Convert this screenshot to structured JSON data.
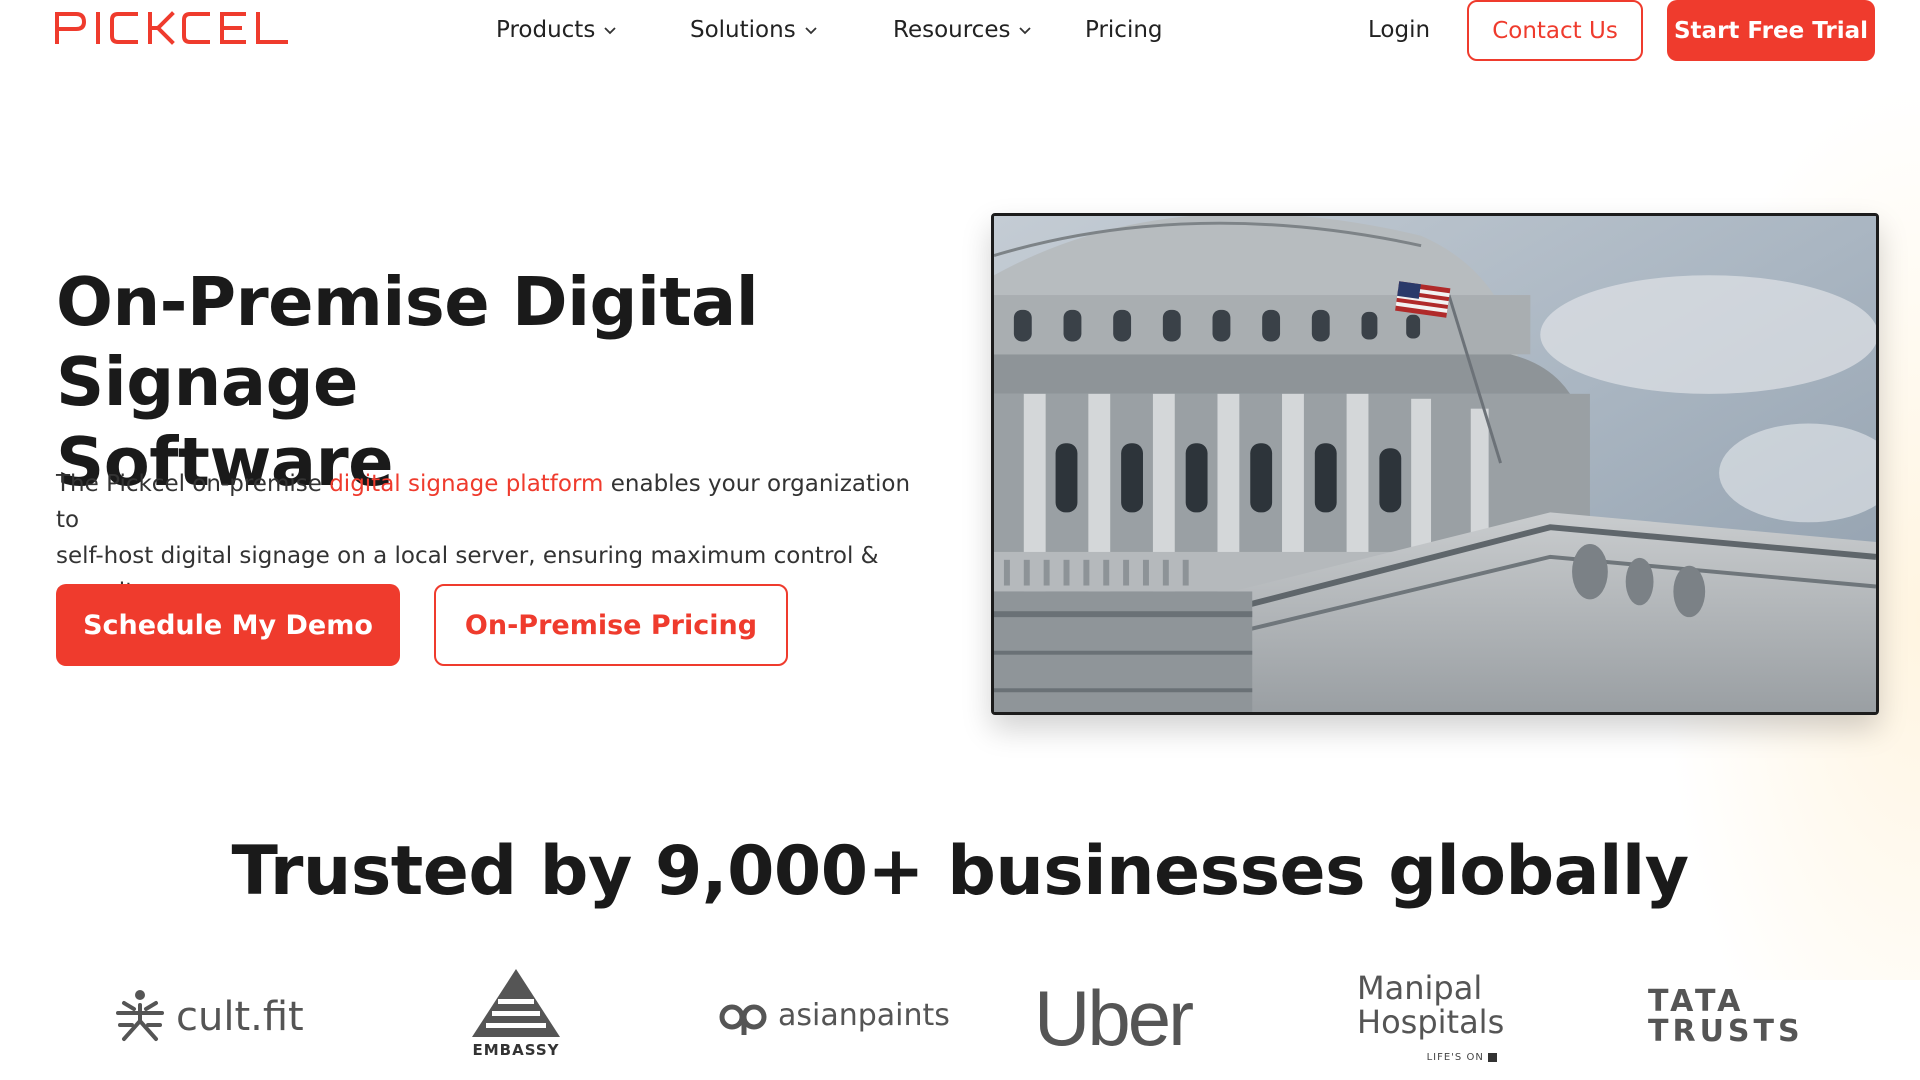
{
  "brand": {
    "logo_text": "PICKCEL",
    "accent_color": "#ef3b2d"
  },
  "nav": {
    "items": [
      {
        "label": "Products",
        "has_dropdown": true
      },
      {
        "label": "Solutions",
        "has_dropdown": true
      },
      {
        "label": "Resources",
        "has_dropdown": true
      },
      {
        "label": "Pricing",
        "has_dropdown": false
      }
    ],
    "login": "Login",
    "contact": "Contact Us",
    "trial": "Start Free Trial"
  },
  "hero": {
    "title_line1": "On-Premise Digital Signage",
    "title_line2": "Software",
    "desc_before": "The Pickcel on-premise ",
    "desc_link": "digital signage platform",
    "desc_after_line1": " enables your organization to",
    "desc_line2": "self-host digital signage on a local server, ensuring maximum control & security",
    "primary_button": "Schedule My Demo",
    "secondary_button": "On-Premise Pricing",
    "image_icon": "capitol-building-photo"
  },
  "trust": {
    "heading": "Trusted by 9,000+ businesses globally",
    "logos": {
      "cultfit": "cult.fit",
      "embassy": "EMBASSY",
      "asianpaints": "asianpaints",
      "uber": "Uber",
      "manipal_line1": "Manipal",
      "manipal_line2": "Hospitals",
      "manipal_tag": "LIFE'S ON",
      "tata_line1": "TATA",
      "tata_line2": "TRUSTS"
    }
  }
}
